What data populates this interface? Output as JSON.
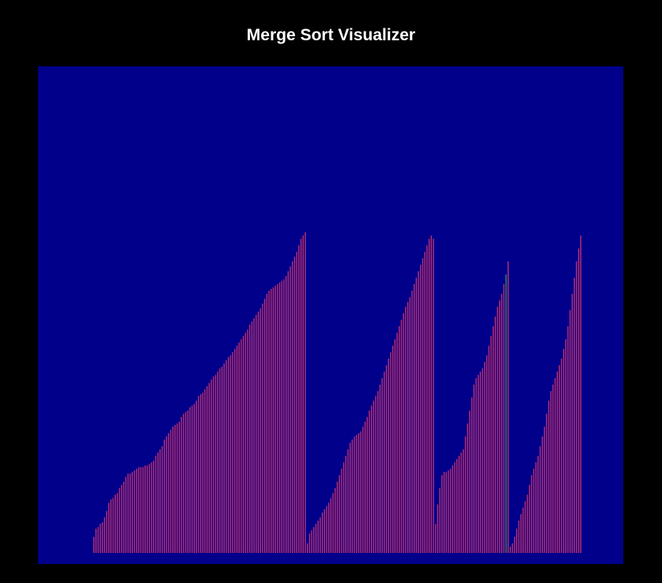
{
  "app": {
    "title": "Merge Sort Visualizer"
  },
  "colors": {
    "background": "#000000",
    "canvas": "#00008b",
    "bar_default": "#c0306a",
    "bar_highlight": "#2e8b57",
    "title": "#ffffff"
  },
  "visualizer": {
    "algorithm": "merge sort",
    "array_length": 200,
    "highlighted_indices": [
      148,
      149,
      150,
      151,
      152,
      153,
      154,
      155,
      156,
      157,
      158,
      159,
      160,
      161,
      162,
      163,
      164,
      165,
      166,
      167,
      168,
      169,
      170,
      171,
      172,
      173,
      174,
      175,
      176,
      177,
      178,
      179,
      180,
      181,
      182,
      183,
      184,
      185,
      186,
      187,
      188,
      189,
      190,
      191,
      192,
      193,
      194,
      195,
      196,
      197,
      198,
      199
    ],
    "values": [
      10,
      15,
      16,
      18,
      19,
      22,
      26,
      31,
      33,
      34,
      36,
      37,
      40,
      42,
      44,
      47,
      49,
      49,
      50,
      51,
      52,
      53,
      53,
      53,
      54,
      54,
      55,
      56,
      57,
      60,
      62,
      64,
      66,
      70,
      72,
      74,
      76,
      78,
      79,
      80,
      81,
      84,
      86,
      87,
      88,
      90,
      91,
      92,
      94,
      97,
      98,
      99,
      101,
      103,
      105,
      107,
      109,
      110,
      112,
      114,
      115,
      117,
      119,
      121,
      122,
      124,
      126,
      128,
      130,
      132,
      134,
      136,
      138,
      141,
      143,
      145,
      147,
      149,
      151,
      154,
      157,
      160,
      162,
      163,
      164,
      165,
      166,
      167,
      168,
      169,
      171,
      174,
      177,
      180,
      183,
      186,
      190,
      194,
      196,
      198,
      6,
      12,
      14,
      16,
      18,
      20,
      22,
      25,
      27,
      29,
      31,
      34,
      37,
      40,
      44,
      48,
      52,
      56,
      60,
      64,
      68,
      70,
      72,
      73,
      74,
      75,
      78,
      81,
      84,
      88,
      91,
      94,
      97,
      100,
      104,
      108,
      112,
      116,
      120,
      124,
      128,
      132,
      136,
      140,
      144,
      148,
      152,
      155,
      158,
      162,
      166,
      170,
      174,
      178,
      182,
      186,
      190,
      194,
      196,
      194,
      18,
      30,
      40,
      48,
      50,
      50,
      51,
      52,
      54,
      56,
      58,
      60,
      62,
      64,
      72,
      80,
      88,
      96,
      104,
      108,
      110,
      112,
      114,
      118,
      122,
      128,
      134,
      140,
      146,
      152,
      156,
      160,
      166,
      172,
      180,
      4,
      6,
      10,
      15,
      20,
      24,
      28,
      32,
      36,
      42,
      48,
      52,
      56,
      60,
      66,
      72,
      78,
      86,
      94,
      100,
      104,
      108,
      112,
      116,
      120,
      126,
      132,
      140,
      150,
      160,
      170,
      180,
      188,
      196
    ]
  }
}
